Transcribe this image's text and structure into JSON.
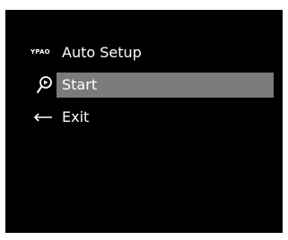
{
  "menu": {
    "badge": "YPAO",
    "title": "Auto Setup",
    "items": [
      {
        "label": "Start",
        "icon": "microphone-icon",
        "selected": true
      },
      {
        "label": "Exit",
        "icon": "return-arrow-icon",
        "selected": false
      }
    ]
  },
  "colors": {
    "screen_background": "#000000",
    "text": "#ffffff",
    "highlight": "#7b7b7b"
  }
}
